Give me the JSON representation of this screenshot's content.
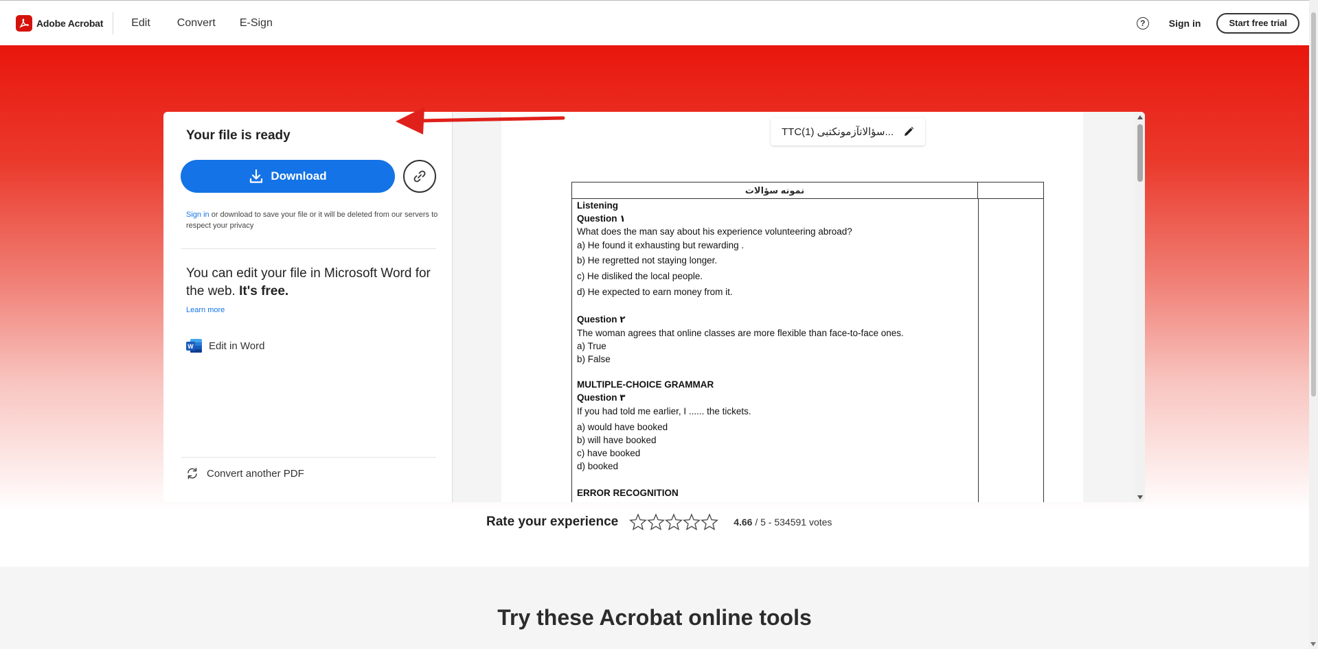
{
  "nav": {
    "brand": "Adobe Acrobat",
    "tabs": [
      {
        "label": "Edit"
      },
      {
        "label": "Convert"
      },
      {
        "label": "E-Sign"
      }
    ],
    "sign_in": "Sign in",
    "start_trial": "Start free trial"
  },
  "panel": {
    "title": "Your file is ready",
    "download_label": "Download",
    "privacy_link": "Sign in",
    "privacy_text": " or download to save your file or it will be deleted from our servers to respect your privacy",
    "promo_text": "You can edit your file in Microsoft Word for the web.",
    "promo_free": "It's free.",
    "learn_more": "Learn more",
    "edit_in_word": "Edit in Word",
    "convert_another": "Convert another PDF"
  },
  "preview": {
    "filename": "TTC(1) سؤالاتآزمونکتبی...",
    "table_header": "نمونه سؤالات",
    "lines": [
      {
        "text": "Listening",
        "bold": true
      },
      {
        "text": "Question ۱",
        "bold": true
      },
      {
        "text": "What does the man say about his experience volunteering abroad?",
        "bold": false
      },
      {
        "text": "a) He found it exhausting but rewarding .",
        "bold": false
      },
      {
        "text": "b) He regretted not staying longer.",
        "bold": false
      },
      {
        "text": "c) He disliked the local people.",
        "bold": false
      },
      {
        "text": "d) He expected to earn money from it.",
        "bold": false
      },
      {
        "text": "Question ۲",
        "bold": true
      },
      {
        "text": "The woman agrees that online classes are more flexible than face-to-face ones.",
        "bold": false
      },
      {
        "text": "a) True",
        "bold": false
      },
      {
        "text": "b) False",
        "bold": false
      },
      {
        "text": "MULTIPLE-CHOICE GRAMMAR",
        "bold": true
      },
      {
        "text": "Question ۳",
        "bold": true
      },
      {
        "text": "If you had told me earlier, I ...... the tickets.",
        "bold": false
      },
      {
        "text": "a) would have booked",
        "bold": false
      },
      {
        "text": "b) will have booked",
        "bold": false
      },
      {
        "text": "c) have booked",
        "bold": false
      },
      {
        "text": "d) booked",
        "bold": false
      },
      {
        "text": "ERROR RECOGNITION",
        "bold": true
      }
    ]
  },
  "rating": {
    "title": "Rate your experience",
    "stars": 5,
    "score": "4.66",
    "scale": " / 5 - 534591 votes"
  },
  "tools": {
    "title": "Try these Acrobat online tools"
  },
  "colors": {
    "adobe_red": "#e9160d",
    "download_blue": "#1473e6",
    "link_blue": "#1473e6"
  },
  "icons": [
    "acrobat-logo-icon",
    "help-icon",
    "download-icon",
    "link-icon",
    "pencil-icon",
    "word-icon",
    "refresh-icon",
    "star-icon"
  ]
}
